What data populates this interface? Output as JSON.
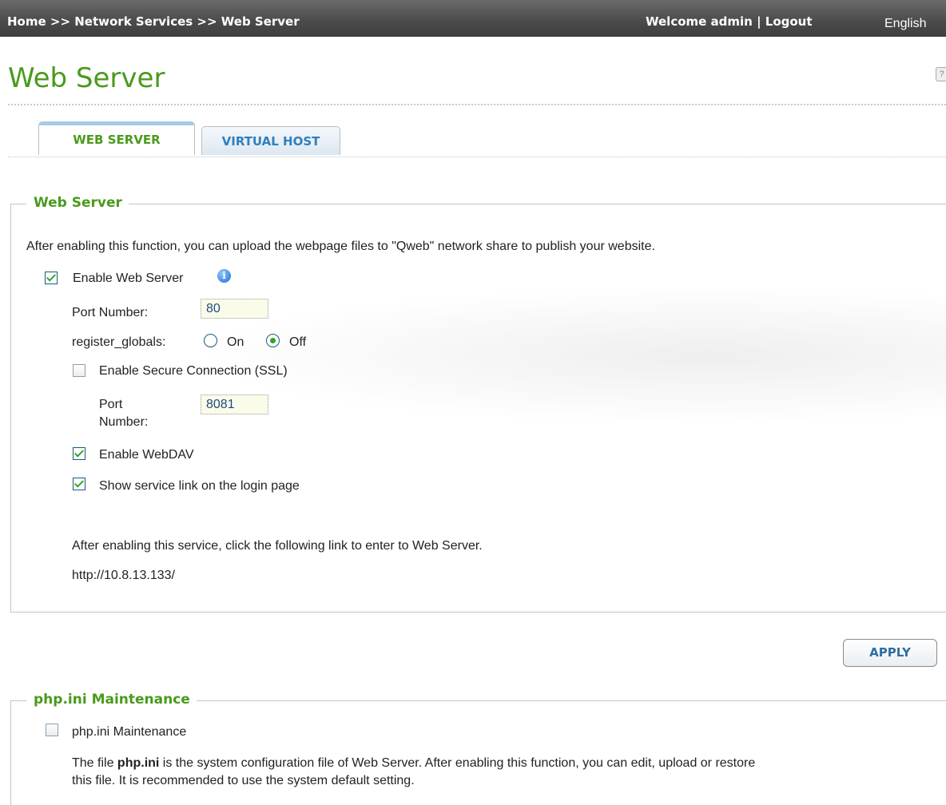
{
  "header": {
    "breadcrumb": "Home >> Network Services >> Web Server",
    "welcome": "Welcome admin | Logout",
    "language": "English"
  },
  "page": {
    "title": "Web Server",
    "help_icon": "?"
  },
  "tabs": [
    {
      "label": "WEB SERVER",
      "active": true
    },
    {
      "label": "VIRTUAL HOST",
      "active": false
    }
  ],
  "web_server": {
    "legend": "Web Server",
    "description": "After enabling this function, you can upload the webpage files to \"Qweb\" network share to publish your website.",
    "enable_label": "Enable Web Server",
    "enable_checked": true,
    "info_icon": "i",
    "port_label": "Port Number:",
    "port_value": "80",
    "register_globals_label": "register_globals:",
    "on_label": "On",
    "off_label": "Off",
    "register_globals_value": "Off",
    "ssl_label": "Enable Secure Connection (SSL)",
    "ssl_checked": false,
    "ssl_port_label_1": "Port",
    "ssl_port_label_2": "Number:",
    "ssl_port_value": "8081",
    "webdav_label": "Enable WebDAV",
    "webdav_checked": true,
    "service_link_label": "Show service link on the login page",
    "service_link_checked": true,
    "link_note": "After enabling this service, click the following link to enter to Web Server.",
    "url": "http://10.8.13.133/"
  },
  "apply_label": "APPLY",
  "php": {
    "legend": "php.ini Maintenance",
    "checkbox_label": "php.ini Maintenance",
    "checked": false,
    "desc_prefix": "The file ",
    "desc_bold": "php.ini",
    "desc_rest": " is the system configuration file of Web Server. After enabling this function, you can edit, upload or restore",
    "desc_line2": "this file. It is recommended to use the system default setting."
  },
  "colors": {
    "accent_green": "#4a9a1c",
    "tab_blue": "#2f7fbf",
    "topbar": "#4a4a4a"
  }
}
